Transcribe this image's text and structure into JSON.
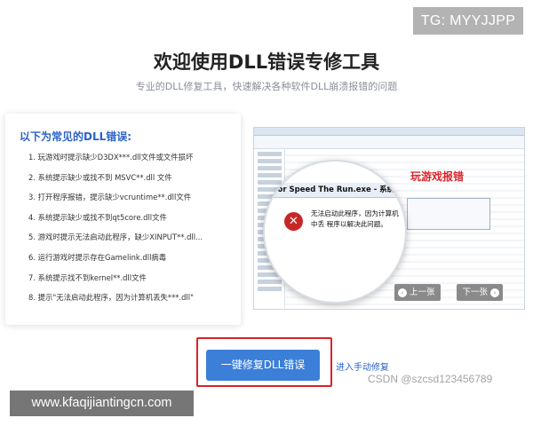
{
  "overlay": {
    "tg_badge": "TG: MYYJJPP",
    "site_watermark": "www.kfaqijiantingcn.com",
    "csdn_watermark": "CSDN @szcsd123456789"
  },
  "header": {
    "title": "欢迎使用DLL错误专修工具",
    "subtitle": "专业的DLL修复工具，快速解决各种软件DLL崩溃报错的问题"
  },
  "error_panel": {
    "heading": "以下为常见的DLL错误:",
    "items": [
      "1. 玩游戏时提示缺少D3DX***.dll文件或文件损坏",
      "2. 系统提示缺少或找不到 MSVC**.dll 文件",
      "3. 打开程序报错，提示缺少vcruntime**.dll文件",
      "4. 系统提示缺少或找不到qt5core.dll文件",
      "5. 游戏时提示无法启动此程序，缺少XINPUT**.dll...",
      "6. 运行游戏时提示存在Gamelink.dll病毒",
      "7. 系统提示找不到kernel**.dll文件",
      "8. 提示\"无法启动此程序，因为计算机丢失***.dll\""
    ]
  },
  "preview": {
    "dialog_title": "d For Speed The Run.exe - 系统错误",
    "dialog_message": "无法启动此程序，因为计算机中丢 程序以解决此问题。",
    "caption": "玩游戏报错",
    "prev_label": "上一张",
    "next_label": "下一张"
  },
  "actions": {
    "fix_button": "一键修复DLL错误",
    "manual_link": "进入手动修复"
  },
  "colors": {
    "accent_blue": "#3b7fd9",
    "heading_blue": "#2a62c9",
    "highlight_red": "#d9232a",
    "caption_red": "#d9262c"
  },
  "icons": {
    "error": "error-x-icon",
    "prev": "chevron-left-icon",
    "next": "chevron-right-icon"
  }
}
